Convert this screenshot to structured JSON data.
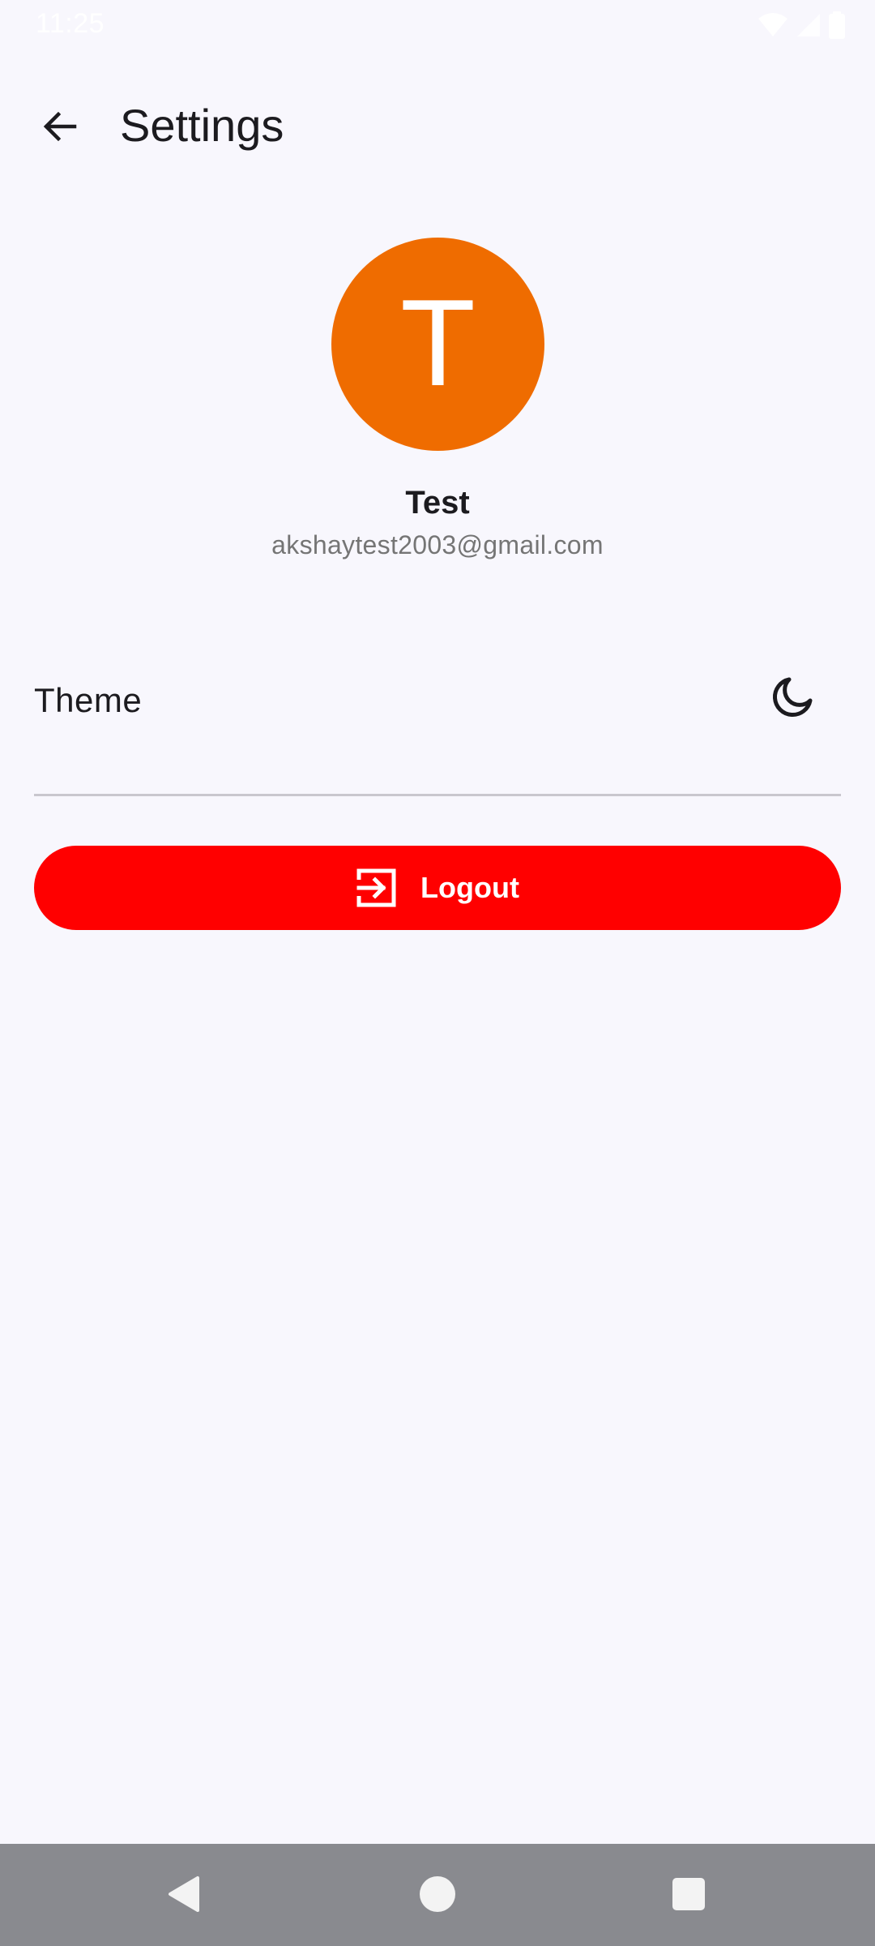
{
  "status_bar": {
    "time": "11:25",
    "icons": [
      "wifi-icon",
      "signal-icon",
      "battery-icon"
    ]
  },
  "app_bar": {
    "title": "Settings",
    "back_icon": "arrow-left-icon"
  },
  "profile": {
    "avatar_initial": "T",
    "avatar_color": "#ef6c00",
    "name": "Test",
    "email": "akshaytest2003@gmail.com"
  },
  "settings": {
    "theme_label": "Theme",
    "theme_icon": "moon-icon"
  },
  "logout": {
    "label": "Logout",
    "icon": "logout-icon",
    "color": "#ff0000"
  },
  "nav_bar": {
    "buttons": [
      "back-triangle-icon",
      "home-circle-icon",
      "recents-square-icon"
    ]
  },
  "colors": {
    "background": "#f8f7fd",
    "accent": "#ef6c00",
    "danger": "#ff0000",
    "nav_bar": "#898a8f"
  }
}
